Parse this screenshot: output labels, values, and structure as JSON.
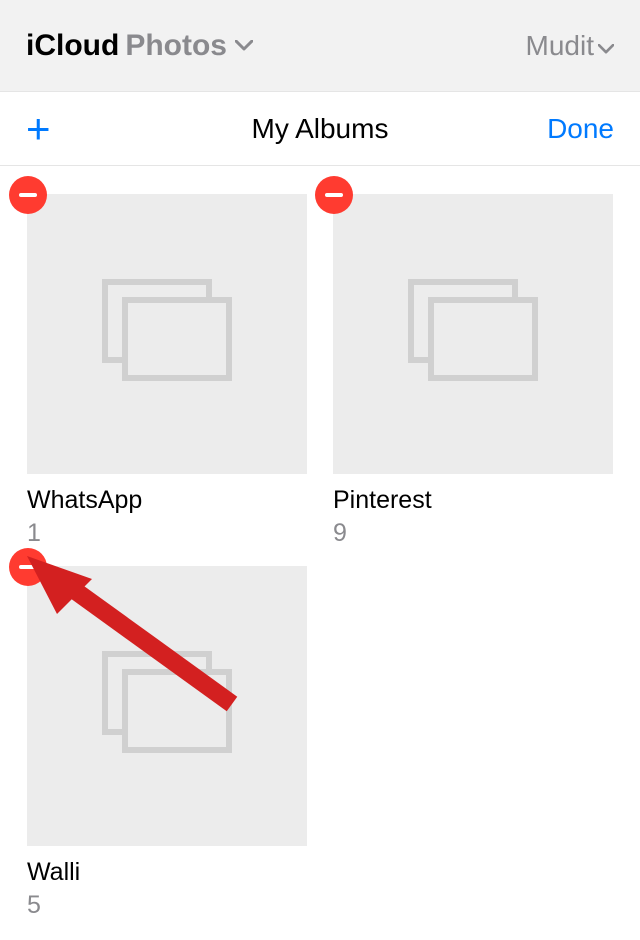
{
  "topbar": {
    "root": "iCloud",
    "section": "Photos",
    "user": "Mudit"
  },
  "toolbar": {
    "add_icon": "plus",
    "title": "My Albums",
    "done_label": "Done"
  },
  "albums": [
    {
      "name": "WhatsApp",
      "count": "1"
    },
    {
      "name": "Pinterest",
      "count": "9"
    },
    {
      "name": "Walli",
      "count": "5"
    }
  ],
  "colors": {
    "accent": "#007aff",
    "delete": "#ff3b30",
    "muted": "#8a8a8e",
    "thumb_bg": "#ececec"
  }
}
